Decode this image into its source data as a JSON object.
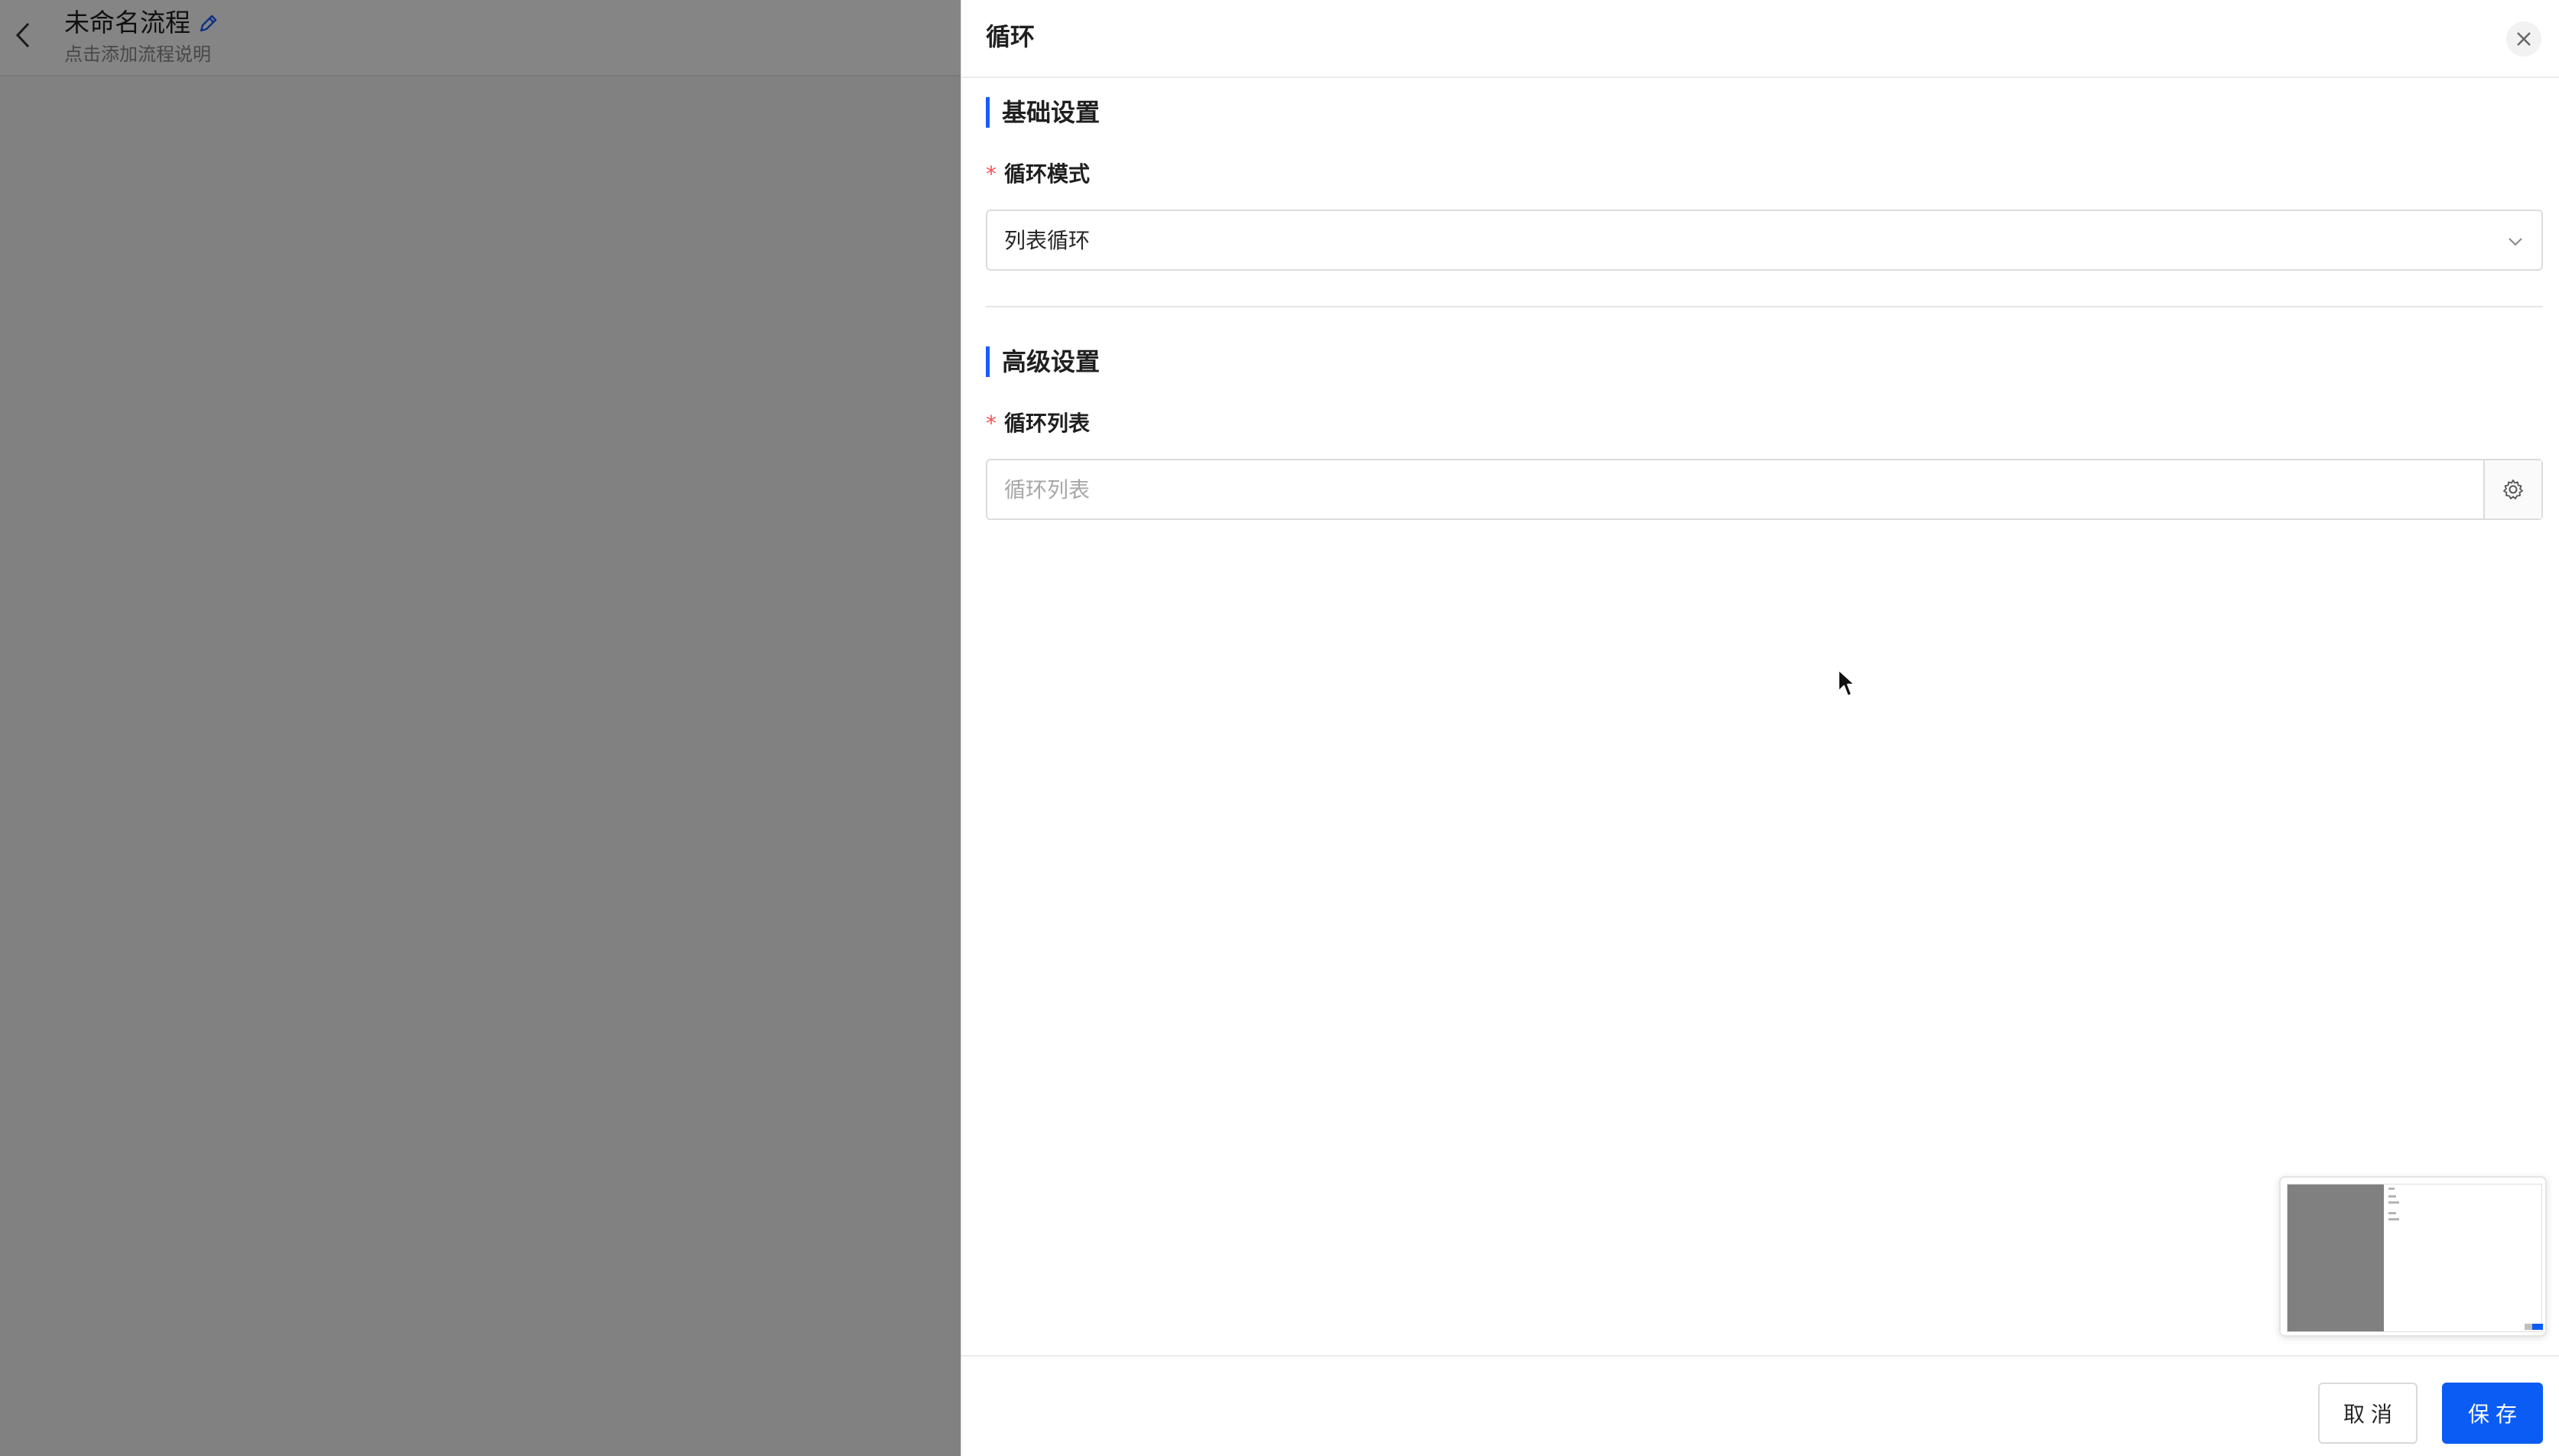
{
  "flow": {
    "title": "未命名流程",
    "description": "点击添加流程说明"
  },
  "drawer": {
    "title": "循环",
    "basic_section": "基础设置",
    "loop_mode": {
      "label": "循环模式",
      "required_mark": "*",
      "value": "列表循环"
    },
    "advanced_section": "高级设置",
    "loop_list": {
      "label": "循环列表",
      "required_mark": "*",
      "placeholder": "循环列表",
      "value": ""
    },
    "cancel_label": "取消",
    "save_label": "保存"
  },
  "icons": {
    "back": "chevron-left-icon",
    "edit": "pencil-icon",
    "close": "close-icon",
    "select_arrow": "chevron-down-icon",
    "settings": "gear-icon",
    "cursor": "mouse-pointer-icon"
  },
  "colors": {
    "accent": "#1a5cff",
    "primary_button": "#0a5cf5",
    "required": "#ff4d4f",
    "mask": "rgba(0,0,0,0.48)"
  }
}
